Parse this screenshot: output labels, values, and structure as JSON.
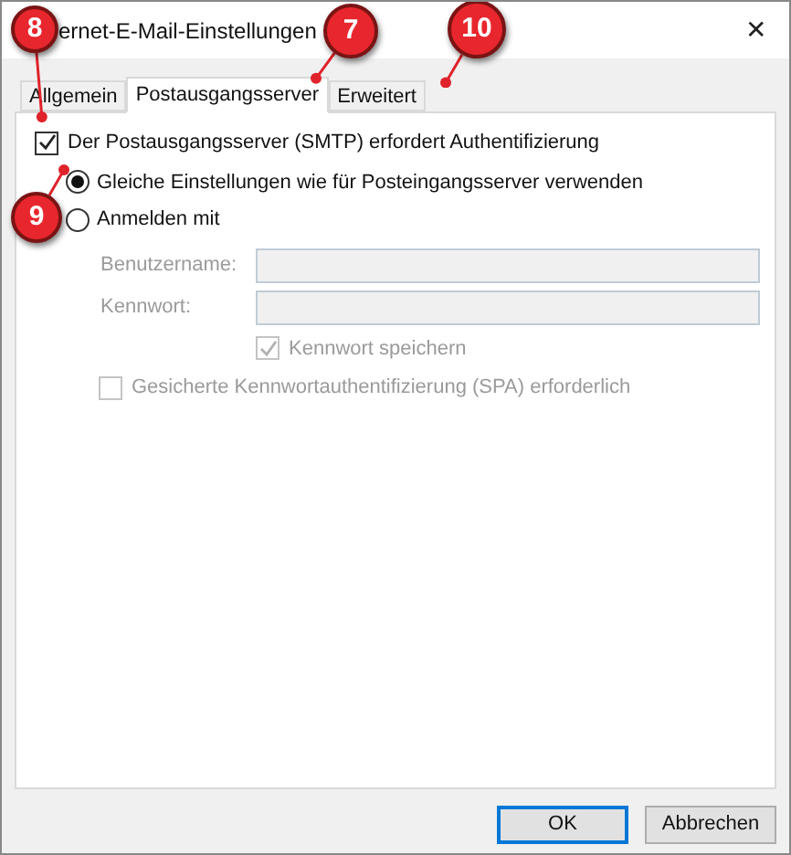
{
  "window": {
    "title": "ernet-E-Mail-Einstellungen",
    "close": "✕"
  },
  "tabs": [
    {
      "label": "Allgemein",
      "selected": false
    },
    {
      "label": "Postausgangsserver",
      "selected": true
    },
    {
      "label": "Erweitert",
      "selected": false
    }
  ],
  "auth_required": {
    "label": "Der Postausgangsserver (SMTP) erfordert Authentifizierung",
    "checked": true
  },
  "auth_options": [
    {
      "label": "Gleiche Einstellungen wie für Posteingangsserver verwenden",
      "selected": true
    },
    {
      "label": "Anmelden mit",
      "selected": false
    }
  ],
  "fields": [
    {
      "label": "Benutzername:",
      "disabled": true
    },
    {
      "label": "Kennwort:",
      "disabled": true
    }
  ],
  "save_password": {
    "label": "Kennwort speichern",
    "checked": true,
    "disabled": true
  },
  "spa": {
    "label": "Gesicherte Kennwortauthentifizierung (SPA) erforderlich",
    "checked": false,
    "disabled": true
  },
  "buttons": [
    {
      "label": "OK",
      "default": true
    },
    {
      "label": "Abbrechen",
      "default": false
    }
  ],
  "callouts": [
    {
      "number": "8"
    },
    {
      "number": "7"
    },
    {
      "number": "10"
    },
    {
      "number": "9"
    }
  ]
}
